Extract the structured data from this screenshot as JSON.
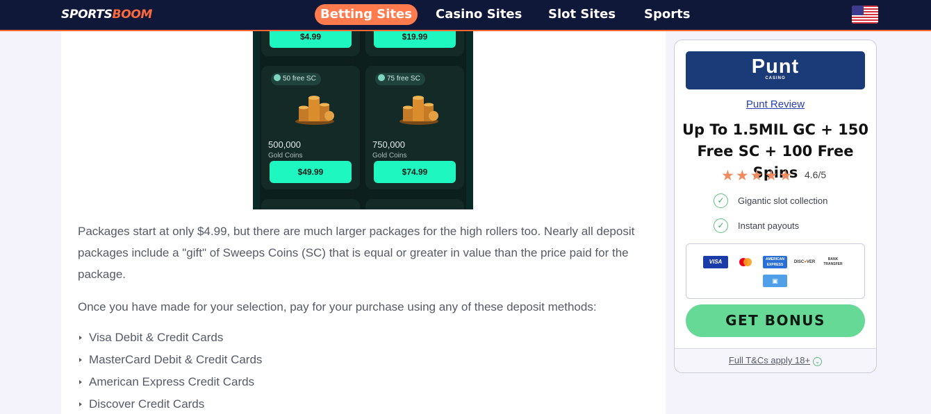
{
  "header": {
    "logo_part1": "SPORTS",
    "logo_part2": "BOOM",
    "nav": [
      {
        "label": "Betting Sites",
        "active": true
      },
      {
        "label": "Casino Sites",
        "active": false
      },
      {
        "label": "Slot Sites",
        "active": false
      },
      {
        "label": "Sports",
        "active": false
      }
    ],
    "flag_icon": "us-flag-icon"
  },
  "screenshot": {
    "packages": [
      {
        "price": "$4.99"
      },
      {
        "price": "$19.99"
      },
      {
        "badge": "50 free SC",
        "amount": "500,000",
        "unit": "Gold Coins",
        "price": "$49.99"
      },
      {
        "badge": "75 free SC",
        "amount": "750,000",
        "unit": "Gold Coins",
        "price": "$74.99"
      }
    ]
  },
  "article": {
    "para1": "Packages start at only $4.99, but there are much larger packages for the high rollers too. Nearly all deposit packages include a \"gift\" of Sweeps Coins (SC) that is equal or greater in value than the price paid for the package.",
    "para2": "Once you have made for your selection, pay for your purchase using any of these deposit methods:",
    "methods": [
      "Visa Debit & Credit Cards",
      "MasterCard Debit & Credit Cards",
      "American Express Credit Cards",
      "Discover Credit Cards"
    ]
  },
  "widget": {
    "brand_name": "Punt",
    "brand_sub": "CASINO",
    "review_link": "Punt Review",
    "offer_line1": "Up To 1.5MIL GC + 150",
    "offer_line2": "Free SC + 100 Free Spins",
    "rating_value": 4.6,
    "rating_text": "4.6/5",
    "features": [
      "Gigantic slot collection",
      "Instant payouts"
    ],
    "payments": [
      "VISA",
      "MASTERCARD",
      "AMERICAN EXPRESS",
      "DISCOVER",
      "BANK TRANSFER",
      "WALLET"
    ],
    "cta": "GET BONUS",
    "terms": "Full T&Cs apply 18+"
  },
  "colors": {
    "header_bg": "#10183a",
    "accent": "#ff7a4d",
    "cta_green": "#67d997",
    "brand_blue": "#1b3a78",
    "star": "#f08a5f",
    "package_button": "#1ff7c0"
  }
}
